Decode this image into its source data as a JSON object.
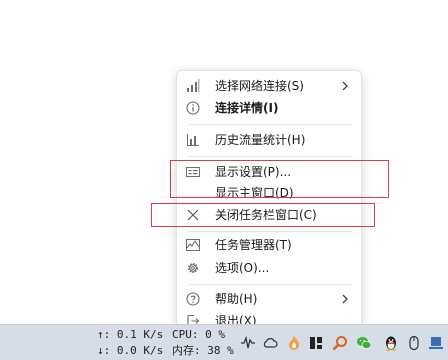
{
  "menu": {
    "items": [
      {
        "label": "选择网络连接(S)",
        "icon": "network-signal-icon",
        "submenu": true
      },
      {
        "label": "连接详情(I)",
        "icon": "info-icon",
        "bold": true
      },
      {
        "label": "历史流量统计(H)",
        "icon": "bar-chart-icon"
      },
      {
        "label": "显示设置(P)...",
        "icon": "display-settings-icon"
      },
      {
        "label": "显示主窗口(D)",
        "icon": ""
      },
      {
        "label": "关闭任务栏窗口(C)",
        "icon": "close-icon"
      },
      {
        "label": "任务管理器(T)",
        "icon": "task-manager-icon"
      },
      {
        "label": "选项(O)...",
        "icon": "gear-icon"
      },
      {
        "label": "帮助(H)",
        "icon": "help-icon",
        "submenu": true
      },
      {
        "label": "退出(X)",
        "icon": "exit-icon"
      }
    ]
  },
  "taskbar": {
    "upload_speed": "↑: 0.1 K/s",
    "download_speed": "↓: 0.0 K/s",
    "cpu_usage": "CPU: 0 %",
    "memory_usage": "内存: 38 %",
    "tray_icons": [
      "audio-wave-icon",
      "cloud-icon",
      "flame-app-icon",
      "bookmark-icon",
      "magnifier-icon",
      "wechat-icon",
      "qq-penguin-icon",
      "mouse-icon",
      "pc-icon"
    ]
  },
  "colors": {
    "highlight_box": "#d43f4f",
    "taskbar_bg": "#d7dde6",
    "menu_bg": "#ffffff",
    "menu_text": "#1a1a1a",
    "icon_gray": "#6e6e6e"
  }
}
